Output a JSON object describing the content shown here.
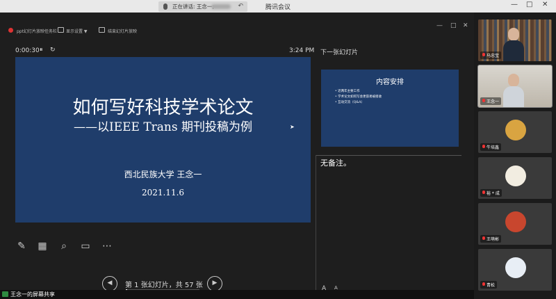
{
  "window": {
    "app_title": "腾讯会议",
    "speaking_label": "正在讲话: 王念一;",
    "minimize": "—",
    "maximize": "□",
    "close": "✕"
  },
  "presenter_toolbar": {
    "item1": "ppt幻灯片放映任务栏",
    "item2": "显示设置 ▼",
    "item3": "结束幻灯片放映",
    "ctl_min": "—",
    "ctl_max": "□",
    "ctl_close": "✕"
  },
  "timer": {
    "elapsed": "0:00:30",
    "pause_icon": "⏸",
    "restart_icon": "↻",
    "clock": "3:24 PM"
  },
  "current_slide": {
    "title": "如何写好科技学术论文",
    "subtitle": "——以IEEE Trans 期刊投稿为例",
    "author": "西北民族大学 王念一",
    "date": "2021.11.6"
  },
  "next_slide": {
    "label": "下一张幻灯片",
    "title": "内容安排",
    "items": [
      "近两年主要工作",
      "学术论文如何写会更容易被接收",
      "互动交流（Q&A）"
    ]
  },
  "notes": {
    "text": "无备注。",
    "font_up": "A",
    "font_down": "A"
  },
  "tools": {
    "pen": "✎",
    "slides_grid": "▦",
    "zoom": "⌕",
    "screen": "▭",
    "more": "⋯"
  },
  "navigation": {
    "prev": "◀",
    "next": "▶",
    "counter": "第 1 张幻灯片，共 57 张",
    "progress": 0.0175
  },
  "share": {
    "label": "王念一的屏幕共享"
  },
  "participants": [
    {
      "name": "马忠宝",
      "type": "video"
    },
    {
      "name": "王念一",
      "type": "video"
    },
    {
      "name": "牛培鑫",
      "type": "avatar",
      "color": "#d9a441"
    },
    {
      "name": "裕 * 成",
      "type": "avatar",
      "color": "#f2ede1"
    },
    {
      "name": "王萌彬",
      "type": "avatar",
      "color": "#c8462e"
    },
    {
      "name": "青松",
      "type": "avatar",
      "color": "#e8eef5"
    }
  ]
}
